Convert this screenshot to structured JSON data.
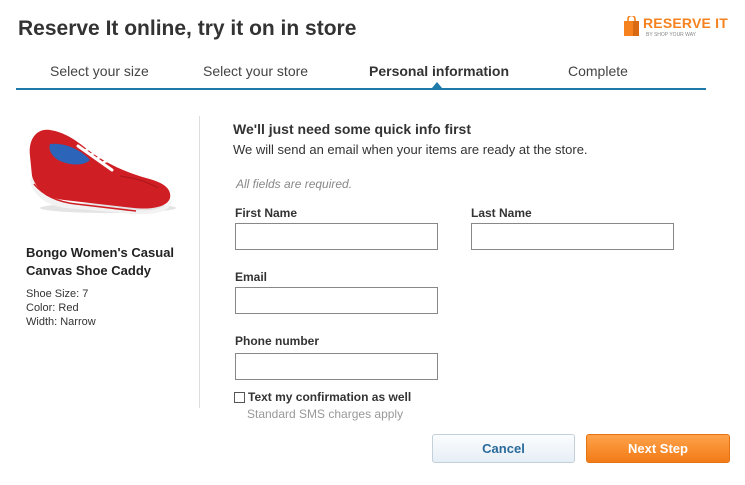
{
  "page": {
    "title": "Reserve It online, try it on in store"
  },
  "logo": {
    "text": "RESERVE IT",
    "subtext": "BY SHOP YOUR WAY"
  },
  "steps": [
    {
      "label": "Select your size",
      "active": false
    },
    {
      "label": "Select your store",
      "active": false
    },
    {
      "label": "Personal information",
      "active": true
    },
    {
      "label": "Complete",
      "active": false
    }
  ],
  "product": {
    "name": "Bongo Women's Casual Canvas Shoe Caddy",
    "details": [
      "Shoe Size: 7",
      "Color: Red",
      "Width: Narrow"
    ]
  },
  "form": {
    "heading": "We'll just need some quick info first",
    "subheading": "We will send an email when your items are ready at the store.",
    "required_note": "All fields are required.",
    "first_name": {
      "label": "First Name",
      "value": ""
    },
    "last_name": {
      "label": "Last Name",
      "value": ""
    },
    "email": {
      "label": "Email",
      "value": ""
    },
    "phone": {
      "label": "Phone number",
      "value": ""
    },
    "sms_checkbox": {
      "label": "Text my confirmation as well",
      "note": "Standard SMS charges apply",
      "checked": false
    }
  },
  "buttons": {
    "cancel": "Cancel",
    "next": "Next Step"
  },
  "colors": {
    "accent": "#1e7aa8",
    "brand_orange": "#f5821f",
    "next_button": "#f27b17",
    "cancel_text": "#2a6a9a"
  }
}
